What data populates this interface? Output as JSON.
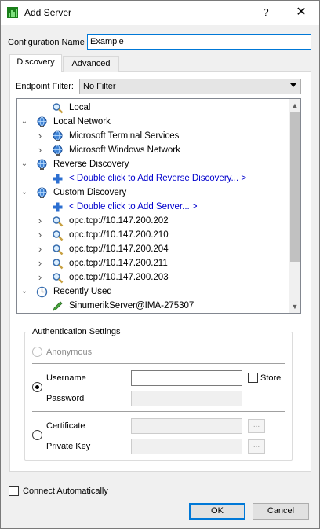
{
  "window": {
    "title": "Add Server",
    "help": "?",
    "close": "✕"
  },
  "config": {
    "label": "Configuration Name",
    "value": "Example"
  },
  "tabs": [
    {
      "label": "Discovery"
    },
    {
      "label": "Advanced"
    }
  ],
  "filter": {
    "label": "Endpoint Filter:",
    "value": "No Filter"
  },
  "tree": [
    {
      "label": "Local",
      "icon": "magnifier-icon",
      "level": 1,
      "chevron": "",
      "link": false
    },
    {
      "label": "Local Network",
      "icon": "network-globe-icon",
      "level": 0,
      "chevron": "expanded",
      "link": false
    },
    {
      "label": "Microsoft Terminal Services",
      "icon": "network-globe-icon",
      "level": 1,
      "chevron": "collapsed",
      "link": false
    },
    {
      "label": "Microsoft Windows Network",
      "icon": "network-globe-icon",
      "level": 1,
      "chevron": "collapsed",
      "link": false
    },
    {
      "label": "Reverse Discovery",
      "icon": "network-globe-icon",
      "level": 0,
      "chevron": "expanded",
      "link": false
    },
    {
      "label": "< Double click to Add Reverse Discovery... >",
      "icon": "plus-icon",
      "level": 1,
      "chevron": "",
      "link": true
    },
    {
      "label": "Custom Discovery",
      "icon": "network-globe-icon",
      "level": 0,
      "chevron": "expanded",
      "link": false
    },
    {
      "label": "< Double click to Add Server... >",
      "icon": "plus-icon",
      "level": 1,
      "chevron": "",
      "link": true
    },
    {
      "label": "opc.tcp://10.147.200.202",
      "icon": "magnifier-icon",
      "level": 1,
      "chevron": "collapsed",
      "link": false
    },
    {
      "label": "opc.tcp://10.147.200.210",
      "icon": "magnifier-icon",
      "level": 1,
      "chevron": "collapsed",
      "link": false
    },
    {
      "label": "opc.tcp://10.147.200.204",
      "icon": "magnifier-icon",
      "level": 1,
      "chevron": "collapsed",
      "link": false
    },
    {
      "label": "opc.tcp://10.147.200.211",
      "icon": "magnifier-icon",
      "level": 1,
      "chevron": "collapsed",
      "link": false
    },
    {
      "label": "opc.tcp://10.147.200.203",
      "icon": "magnifier-icon",
      "level": 1,
      "chevron": "collapsed",
      "link": false
    },
    {
      "label": "Recently Used",
      "icon": "clock-icon",
      "level": 0,
      "chevron": "expanded",
      "link": false
    },
    {
      "label": "SinumerikServer@IMA-275307",
      "icon": "pencil-icon",
      "level": 1,
      "chevron": "",
      "link": false
    }
  ],
  "auth": {
    "title": "Authentication Settings",
    "anonymous": "Anonymous",
    "username": "Username",
    "password": "Password",
    "store": "Store",
    "certificate": "Certificate",
    "private_key": "Private Key",
    "browse": "..."
  },
  "connect_auto": "Connect Automatically",
  "buttons": {
    "ok": "OK",
    "cancel": "Cancel"
  }
}
